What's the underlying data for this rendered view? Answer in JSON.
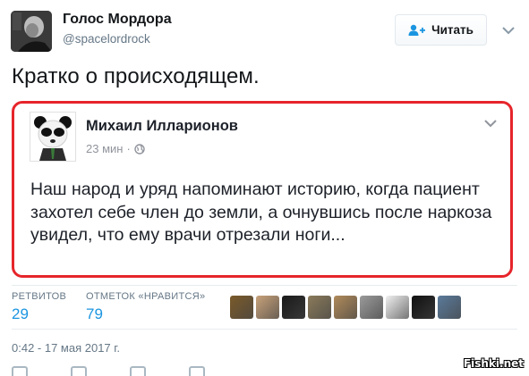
{
  "header": {
    "author_name": "Голос Мордора",
    "author_handle": "@spacelordrock",
    "follow_label": "Читать"
  },
  "tweet": {
    "text": "Кратко о происходящем."
  },
  "embedded_post": {
    "author_name": "Михаил Илларионов",
    "time": "23 мин",
    "separator": "·",
    "text": "Наш народ и уряд напоминают историю, когда пациент захотел себе член до земли, а очнувшись после наркоза увидел, что ему врачи отрезали ноги..."
  },
  "stats": {
    "retweets_label": "РЕТВИТОВ",
    "retweets_count": "29",
    "likes_label": "ОТМЕТОК «НРАВИТСЯ»",
    "likes_count": "79"
  },
  "likers": [
    {
      "name": "liker-avatar-1",
      "color": "#7a5a2a"
    },
    {
      "name": "liker-avatar-2",
      "color": "#c8a27a"
    },
    {
      "name": "liker-avatar-3",
      "color": "#1a1a1a"
    },
    {
      "name": "liker-avatar-4",
      "color": "#8a7a5a"
    },
    {
      "name": "liker-avatar-5",
      "color": "#b08a5a"
    },
    {
      "name": "liker-avatar-6",
      "color": "#9a9a9a"
    },
    {
      "name": "liker-avatar-7",
      "color": "#f0f0f0"
    },
    {
      "name": "liker-avatar-8",
      "color": "#111111"
    },
    {
      "name": "liker-avatar-9",
      "color": "#5a7a9a"
    }
  ],
  "timestamp": "0:42 - 17 мая 2017 г.",
  "watermark": "Fishki.net",
  "colors": {
    "accent": "#1b95e0",
    "highlight_border": "#e6252b"
  }
}
